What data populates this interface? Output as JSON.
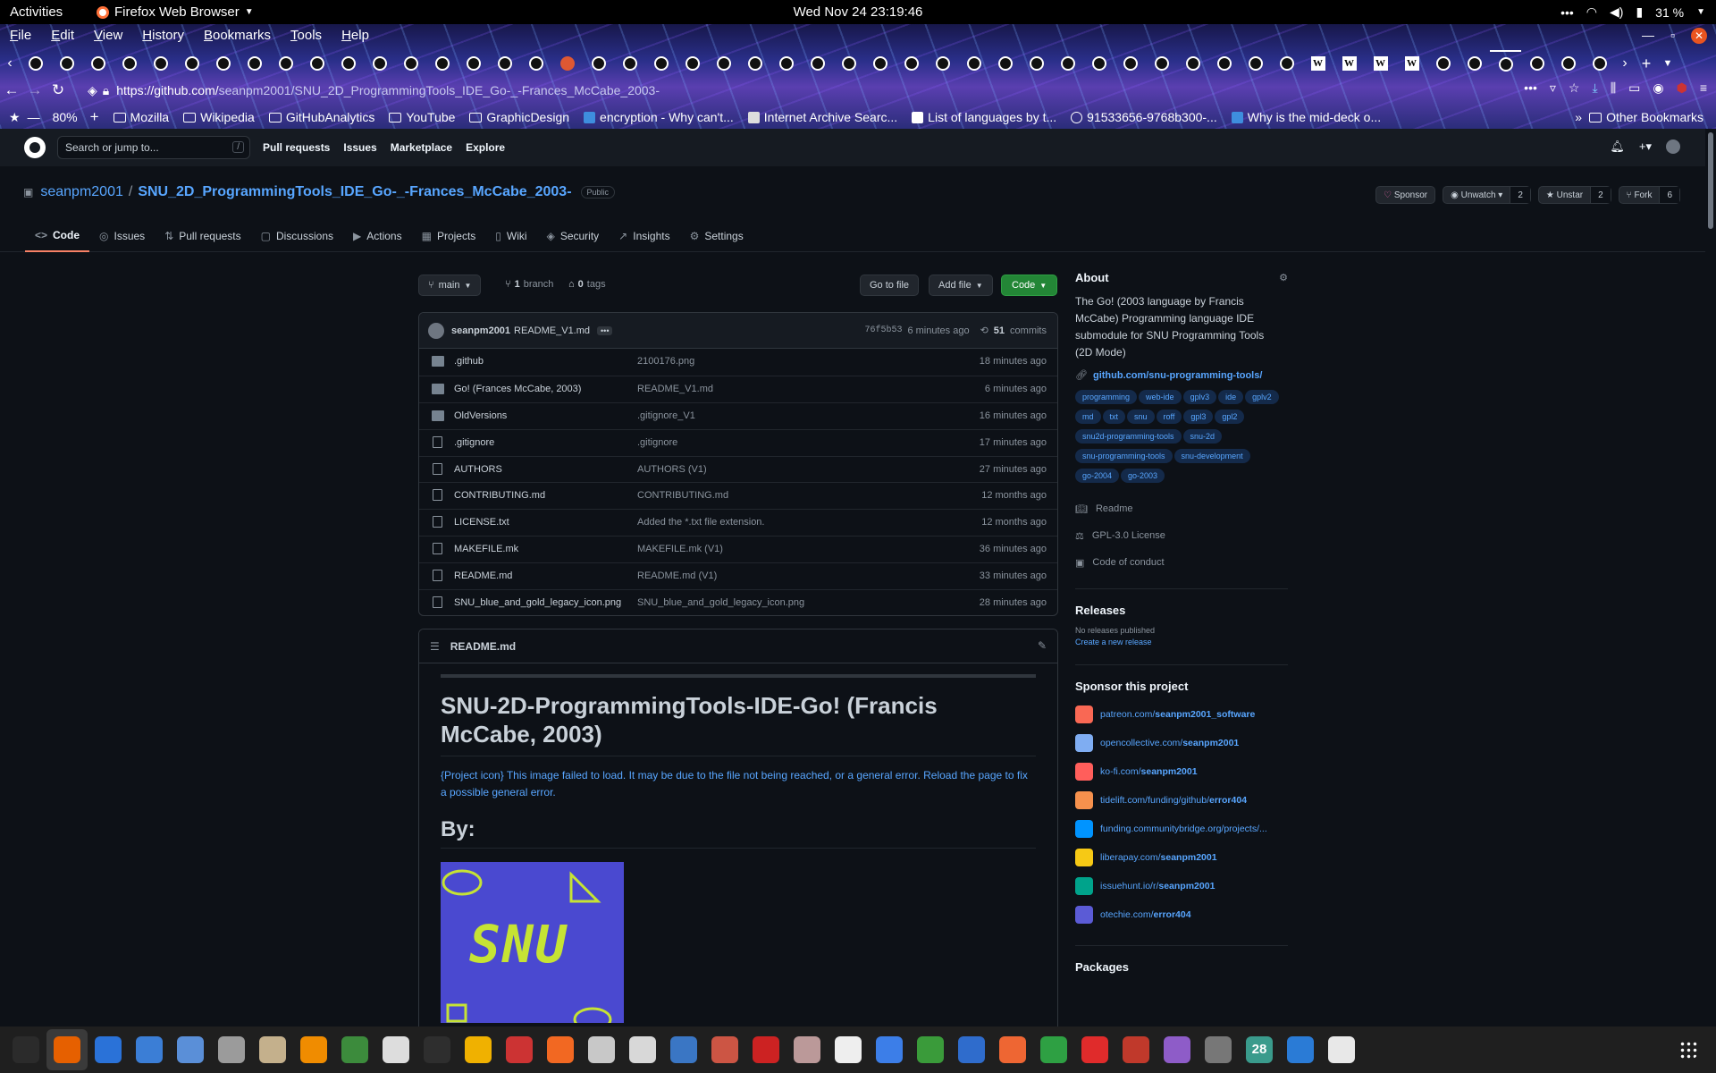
{
  "topbar": {
    "activities": "Activities",
    "app_name": "Firefox Web Browser",
    "clock": "Wed Nov 24  23:19:46",
    "battery": "31 %"
  },
  "menubar": [
    "File",
    "Edit",
    "View",
    "History",
    "Bookmarks",
    "Tools",
    "Help"
  ],
  "tabs": {
    "count_github": 41,
    "icons": [
      "github",
      "github",
      "github",
      "github",
      "github",
      "github",
      "github",
      "github",
      "github",
      "github",
      "github",
      "github",
      "github",
      "github",
      "github",
      "github",
      "github",
      "duckduckgo",
      "github",
      "github",
      "github",
      "github",
      "github",
      "github",
      "github",
      "github",
      "github",
      "github",
      "github",
      "github",
      "github",
      "github",
      "github",
      "github",
      "github",
      "github",
      "github",
      "github",
      "github",
      "github",
      "github",
      "wikipedia",
      "wikipedia",
      "wikipedia",
      "wikipedia",
      "github",
      "github",
      "github",
      "github",
      "github",
      "github"
    ]
  },
  "url": {
    "host": "https://github.com/",
    "rest": "seanpm2001/SNU_2D_ProgrammingTools_IDE_Go-_-Frances_McCabe_2003-"
  },
  "bookmarks": {
    "zoom": "80%",
    "items": [
      {
        "label": "Mozilla",
        "icon": "folder-icon"
      },
      {
        "label": "Wikipedia",
        "icon": "folder-icon"
      },
      {
        "label": "GitHubAnalytics",
        "icon": "folder-icon"
      },
      {
        "label": "YouTube",
        "icon": "folder-icon"
      },
      {
        "label": "GraphicDesign",
        "icon": "folder-icon"
      },
      {
        "label": "encryption - Why can't...",
        "icon": "stackexchange-icon"
      },
      {
        "label": "Internet Archive Searc...",
        "icon": "archive-icon"
      },
      {
        "label": "List of languages by t...",
        "icon": "wikipedia-icon"
      },
      {
        "label": "91533656-9768b300-...",
        "icon": "globe-icon"
      },
      {
        "label": "Why is the mid-deck o...",
        "icon": "stackexchange-icon"
      }
    ],
    "other": "Other Bookmarks"
  },
  "gh": {
    "search_placeholder": "Search or jump to...",
    "slash": "/",
    "nav": [
      "Pull requests",
      "Issues",
      "Marketplace",
      "Explore"
    ]
  },
  "repo": {
    "owner": "seanpm2001",
    "sep": "/",
    "name": "SNU_2D_ProgrammingTools_IDE_Go-_-Frances_McCabe_2003-",
    "visibility": "Public",
    "sponsor": "Sponsor",
    "unwatch": "Unwatch",
    "watch_count": "2",
    "unstar": "Unstar",
    "star_count": "2",
    "fork": "Fork",
    "fork_count": "6",
    "tabs": [
      {
        "label": "Code",
        "icon": "<>"
      },
      {
        "label": "Issues",
        "icon": "◎"
      },
      {
        "label": "Pull requests",
        "icon": "⇅"
      },
      {
        "label": "Discussions",
        "icon": "▢"
      },
      {
        "label": "Actions",
        "icon": "▶"
      },
      {
        "label": "Projects",
        "icon": "▦"
      },
      {
        "label": "Wiki",
        "icon": "▯"
      },
      {
        "label": "Security",
        "icon": "◈"
      },
      {
        "label": "Insights",
        "icon": "↗"
      },
      {
        "label": "Settings",
        "icon": "⚙"
      }
    ]
  },
  "files": {
    "branch": "main",
    "branch_count": "1",
    "branch_label": "branch",
    "tag_count": "0",
    "tag_label": "tags",
    "goto": "Go to file",
    "add": "Add file",
    "code": "Code",
    "commit": {
      "author": "seanpm2001",
      "message": "README_V1.md",
      "hash": "76f5b53",
      "when": "6 minutes ago",
      "count": "51",
      "count_label": "commits"
    },
    "rows": [
      {
        "name": ".github",
        "type": "dir",
        "msg": "2100176.png",
        "time": "18 minutes ago"
      },
      {
        "name": "Go! (Frances McCabe, 2003)",
        "type": "dir",
        "msg": "README_V1.md",
        "time": "6 minutes ago"
      },
      {
        "name": "OldVersions",
        "type": "dir",
        "msg": ".gitignore_V1",
        "time": "16 minutes ago"
      },
      {
        "name": ".gitignore",
        "type": "file",
        "msg": ".gitignore",
        "time": "17 minutes ago"
      },
      {
        "name": "AUTHORS",
        "type": "file",
        "msg": "AUTHORS (V1)",
        "time": "27 minutes ago"
      },
      {
        "name": "CONTRIBUTING.md",
        "type": "file",
        "msg": "CONTRIBUTING.md",
        "time": "12 months ago"
      },
      {
        "name": "LICENSE.txt",
        "type": "file",
        "msg": "Added the *.txt file extension.",
        "time": "12 months ago"
      },
      {
        "name": "MAKEFILE.mk",
        "type": "file",
        "msg": "MAKEFILE.mk (V1)",
        "time": "36 minutes ago"
      },
      {
        "name": "README.md",
        "type": "file",
        "msg": "README.md (V1)",
        "time": "33 minutes ago"
      },
      {
        "name": "SNU_blue_and_gold_legacy_icon.png",
        "type": "file",
        "msg": "SNU_blue_and_gold_legacy_icon.png",
        "time": "28 minutes ago"
      }
    ]
  },
  "readme": {
    "filename": "README.md",
    "title": "SNU-2D-ProgrammingTools-IDE-Go! (Francis McCabe, 2003)",
    "broken_image": "{Project icon} This image failed to load. It may be due to the file not being reached, or a general error. Reload the page to fix a possible general error.",
    "by": "By:",
    "logo_text": "SNU"
  },
  "about": {
    "heading": "About",
    "description": "The Go! (2003 language by Francis McCabe) Programming language IDE submodule for SNU Programming Tools (2D Mode)",
    "link": "github.com/snu-programming-tools/",
    "topics": [
      "programming",
      "web-ide",
      "gplv3",
      "ide",
      "gplv2",
      "md",
      "txt",
      "snu",
      "roff",
      "gpl3",
      "gpl2",
      "snu2d-programming-tools",
      "snu-2d",
      "snu-programming-tools",
      "snu-development",
      "go-2004",
      "go-2003"
    ],
    "readme": "Readme",
    "license": "GPL-3.0 License",
    "conduct": "Code of conduct"
  },
  "releases": {
    "heading": "Releases",
    "none": "No releases published",
    "create": "Create a new release"
  },
  "sponsor": {
    "heading": "Sponsor this project",
    "links": [
      {
        "pre": "patreon.com/",
        "bold": "seanpm2001_software",
        "color": "#f96854"
      },
      {
        "pre": "opencollective.com/",
        "bold": "seanpm2001",
        "color": "#7fadf2"
      },
      {
        "pre": "ko-fi.com/",
        "bold": "seanpm2001",
        "color": "#ff5e5b"
      },
      {
        "pre": "tidelift.com/funding/github/",
        "bold": "error404",
        "color": "#f6914d"
      },
      {
        "pre": "funding.communitybridge.org/projects/...",
        "bold": "",
        "color": "#0094ff"
      },
      {
        "pre": "liberapay.com/",
        "bold": "seanpm2001",
        "color": "#f6c915"
      },
      {
        "pre": "issuehunt.io/r/",
        "bold": "seanpm2001",
        "color": "#00a38b"
      },
      {
        "pre": "otechie.com/",
        "bold": "error404",
        "color": "#5b5bd6"
      }
    ]
  },
  "packages": {
    "heading": "Packages"
  },
  "taskbar": {
    "calendar_day": "28",
    "apps": [
      {
        "name": "system-monitor",
        "color": "#2b2b2b"
      },
      {
        "name": "firefox",
        "color": "#e66000"
      },
      {
        "name": "writer",
        "color": "#2a72d8"
      },
      {
        "name": "help",
        "color": "#3b7ed6"
      },
      {
        "name": "text-editor",
        "color": "#5a8fd8"
      },
      {
        "name": "settings",
        "color": "#9b9b9b"
      },
      {
        "name": "files",
        "color": "#c4b08c"
      },
      {
        "name": "vlc",
        "color": "#f08c00"
      },
      {
        "name": "gimp-addon",
        "color": "#3c8b3c"
      },
      {
        "name": "inkscape",
        "color": "#ddd"
      },
      {
        "name": "terminal",
        "color": "#2e2e2e"
      },
      {
        "name": "calculator",
        "color": "#f0b100"
      },
      {
        "name": "monitor",
        "color": "#c33"
      },
      {
        "name": "software",
        "color": "#f26822"
      },
      {
        "name": "search",
        "color": "#c8c8c8"
      },
      {
        "name": "disk",
        "color": "#d8d8d8"
      },
      {
        "name": "image-viewer",
        "color": "#3a76c4"
      },
      {
        "name": "impress",
        "color": "#c54"
      },
      {
        "name": "pdf",
        "color": "#c22"
      },
      {
        "name": "archive",
        "color": "#b99"
      },
      {
        "name": "font-viewer",
        "color": "#eee"
      },
      {
        "name": "todo",
        "color": "#3c7ee8"
      },
      {
        "name": "vim",
        "color": "#3a9b3a"
      },
      {
        "name": "remote",
        "color": "#2f6ccc"
      },
      {
        "name": "backup",
        "color": "#ee6633"
      },
      {
        "name": "calc",
        "color": "#2ea043"
      },
      {
        "name": "alert",
        "color": "#e02b2b"
      },
      {
        "name": "game",
        "color": "#c0392b"
      },
      {
        "name": "camera",
        "color": "#8e5cc8"
      },
      {
        "name": "gnome-sudoku",
        "color": "#777"
      },
      {
        "name": "calendar",
        "color": "#3a9b8c"
      },
      {
        "name": "thunderbird",
        "color": "#2a7bd6"
      },
      {
        "name": "music",
        "color": "#e8e8e8"
      },
      {
        "name": "app-grid",
        "color": "#aaa"
      }
    ]
  }
}
